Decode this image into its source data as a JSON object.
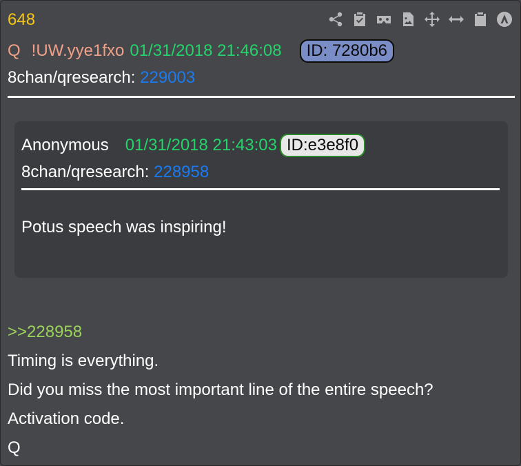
{
  "post": {
    "number": "648",
    "author": "Q",
    "tripcode": "!UW.yye1fxo",
    "timestamp": "01/31/2018 21:46:08",
    "id": "ID: 7280b6",
    "board_prefix": "8chan/qresearch: ",
    "post_ref": "229003"
  },
  "toolbar": {
    "icons": [
      "share-icon",
      "clipboard-check-icon",
      "vr-viewer-icon",
      "image-file-icon",
      "move-icon",
      "horizontal-arrows-icon",
      "clipboard-icon",
      "navigation-icon"
    ]
  },
  "quoted": {
    "author": "Anonymous",
    "timestamp": "01/31/2018 21:43:03",
    "id": "ID:e3e8f0",
    "board_prefix": "8chan/qresearch: ",
    "post_ref": "228958",
    "text": "Potus speech was inspiring!"
  },
  "body": {
    "reply_ref": ">>228958",
    "lines": [
      "Timing is everything.",
      "Did you miss the most important line of the entire speech?",
      "Activation code.",
      "Q"
    ]
  },
  "colors": {
    "background": "#46474b",
    "quoted_background": "#3b3c40",
    "post_number": "#f5c518",
    "author": "#f0a088",
    "timestamp": "#24d36b",
    "link": "#1a7bf0",
    "greentext": "#9bd25a",
    "id_badge_main": "#7a8dc6"
  }
}
